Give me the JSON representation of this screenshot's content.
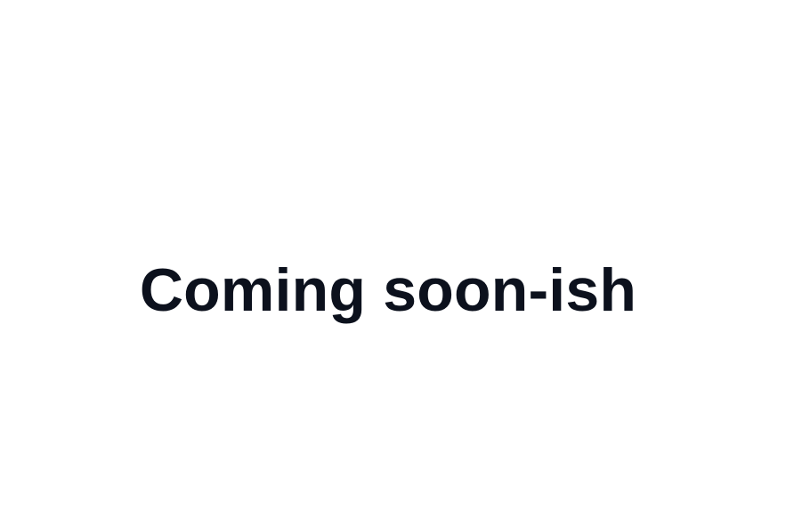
{
  "main": {
    "headline": "Coming soon-ish"
  },
  "colors": {
    "background": "#ffffff",
    "text": "#0c111d"
  }
}
